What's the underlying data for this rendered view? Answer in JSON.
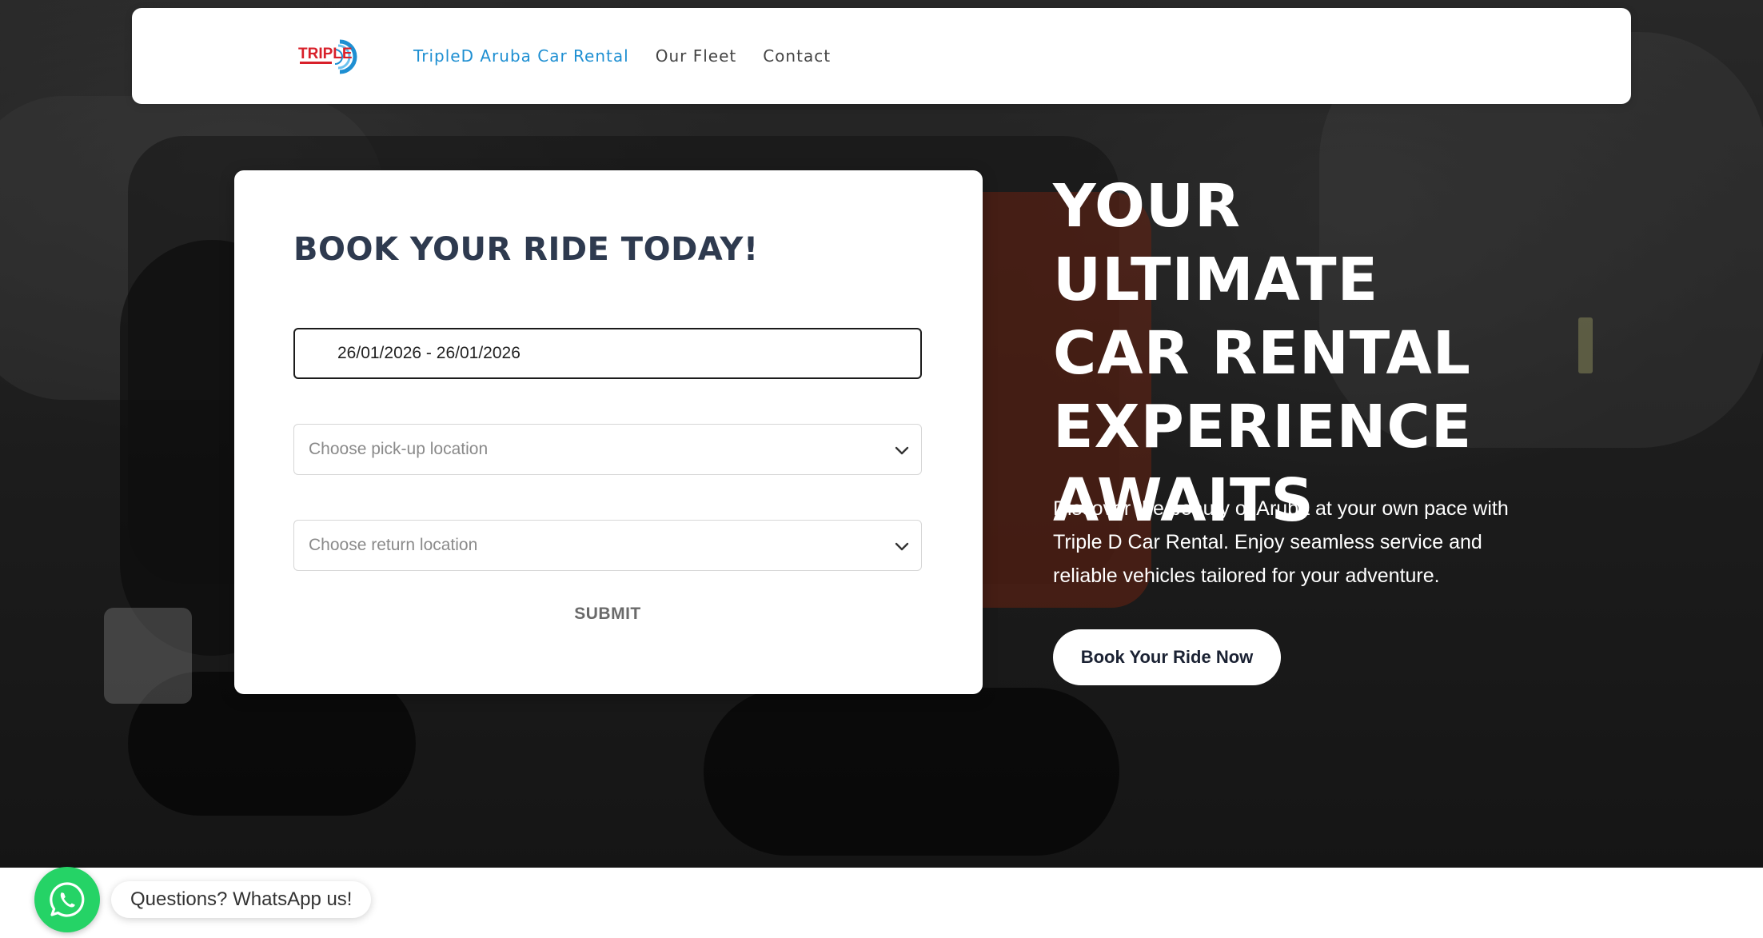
{
  "navbar": {
    "logo_text": "TRIPLE",
    "links": [
      {
        "label": "TripleD Aruba Car Rental",
        "active": true
      },
      {
        "label": "Our Fleet",
        "active": false
      },
      {
        "label": "Contact",
        "active": false
      }
    ]
  },
  "booking": {
    "title": "BOOK YOUR RIDE TODAY!",
    "date_range_value": "26/01/2026 - 26/01/2026",
    "pickup_placeholder": "Choose pick-up location",
    "return_placeholder": "Choose return location",
    "submit_label": "SUBMIT"
  },
  "hero": {
    "heading_lines": [
      "YOUR ULTIMATE",
      "CAR RENTAL",
      "EXPERIENCE",
      "AWAITS"
    ],
    "description": "Discover the beauty of Aruba at your own pace with Triple D Car Rental. Enjoy seamless service and reliable vehicles tailored for your adventure.",
    "cta_label": "Book Your Ride Now"
  },
  "whatsapp": {
    "label": "Questions? WhatsApp us!"
  },
  "colors": {
    "nav_active": "#1e8fd2",
    "nav_text": "#444444",
    "title_text": "#2e3a4f",
    "whatsapp_green": "#25d366",
    "cta_text": "#1b2233"
  }
}
